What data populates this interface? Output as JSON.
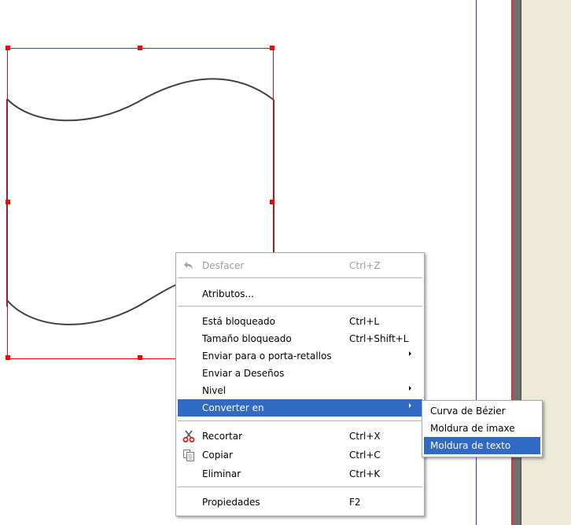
{
  "context_menu": {
    "items": [
      {
        "label": "Desfacer",
        "shortcut": "Ctrl+Z",
        "icon": "undo-icon",
        "disabled": true
      },
      {
        "label": "Atributos..."
      },
      {
        "label": "Está bloqueado",
        "shortcut": "Ctrl+L"
      },
      {
        "label": "Tamaño bloqueado",
        "shortcut": "Ctrl+Shift+L"
      },
      {
        "label": "Enviar para o porta-retallos",
        "submenu": true
      },
      {
        "label": "Enviar a Deseños"
      },
      {
        "label": "Nivel",
        "submenu": true
      },
      {
        "label": "Converter en",
        "submenu": true,
        "highlighted": true
      },
      {
        "label": "Recortar",
        "shortcut": "Ctrl+X",
        "icon": "scissors-icon"
      },
      {
        "label": "Copiar",
        "shortcut": "Ctrl+C",
        "icon": "copy-icon"
      },
      {
        "label": "Eliminar",
        "shortcut": "Ctrl+K"
      },
      {
        "label": "Propiedades",
        "shortcut": "F2"
      }
    ]
  },
  "convert_submenu": {
    "items": [
      {
        "label": "Curva de Bézier"
      },
      {
        "label": "Moldura de imaxe"
      },
      {
        "label": "Moldura de texto",
        "highlighted": true
      }
    ]
  },
  "colors": {
    "selection": "#ff0000",
    "highlight": "#316ac5",
    "margin_guide": "#2f2fd8",
    "pasteboard": "#ece9d8"
  }
}
